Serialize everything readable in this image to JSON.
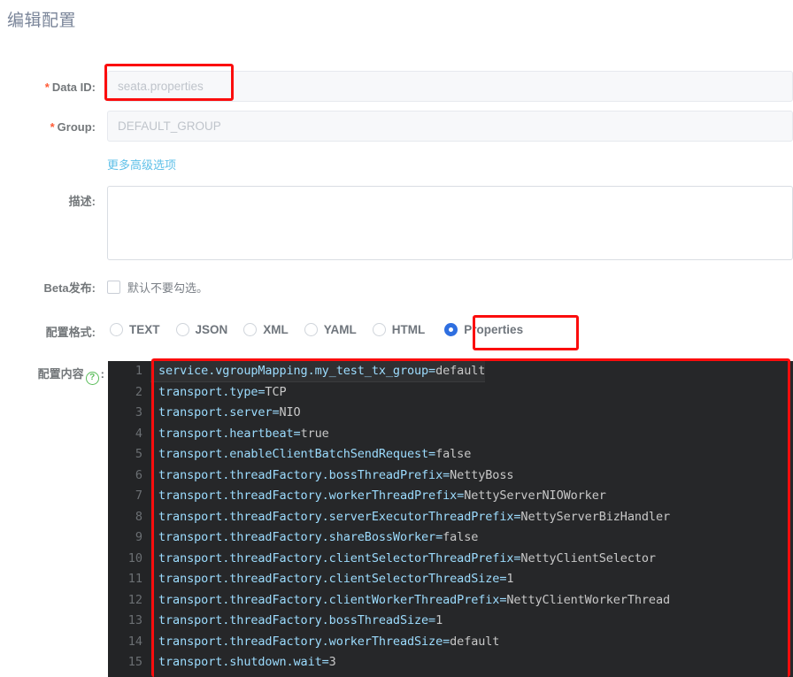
{
  "page": {
    "title": "编辑配置"
  },
  "form": {
    "data_id": {
      "label": "Data ID",
      "required_mark": "*",
      "value": "seata.properties",
      "placeholder": "seata.properties"
    },
    "group": {
      "label": "Group",
      "required_mark": "*",
      "value": "DEFAULT_GROUP",
      "placeholder": "DEFAULT_GROUP"
    },
    "advanced_link": "更多高级选项",
    "description": {
      "label": "描述",
      "value": "",
      "placeholder": ""
    },
    "beta": {
      "label": "Beta发布",
      "checkbox_text": "默认不要勾选。",
      "checked": false
    },
    "format": {
      "label": "配置格式",
      "selected": "Properties",
      "options": [
        "TEXT",
        "JSON",
        "XML",
        "YAML",
        "HTML",
        "Properties"
      ]
    },
    "content": {
      "label": "配置内容",
      "help_icon": "question-mark-icon",
      "help_glyph": "?",
      "colon": ":"
    }
  },
  "colors": {
    "annotation": "#fb0d0d",
    "radio_selected": "#2f6fe0",
    "link": "#5fc0e8",
    "required_star": "#ff5b36",
    "help": "#5bbd5b",
    "editor_bg": "#262729",
    "editor_gutter": "#232426",
    "code_key": "#9cdcfe",
    "code_value": "#c8c8c8"
  },
  "editor": {
    "lines": [
      {
        "n": "1",
        "key": "service.vgroupMapping.my_test_tx_group=",
        "val": "default"
      },
      {
        "n": "2",
        "key": "transport.type=",
        "val": "TCP"
      },
      {
        "n": "3",
        "key": "transport.server=",
        "val": "NIO"
      },
      {
        "n": "4",
        "key": "transport.heartbeat=",
        "val": "true"
      },
      {
        "n": "5",
        "key": "transport.enableClientBatchSendRequest=",
        "val": "false"
      },
      {
        "n": "6",
        "key": "transport.threadFactory.bossThreadPrefix=",
        "val": "NettyBoss"
      },
      {
        "n": "7",
        "key": "transport.threadFactory.workerThreadPrefix=",
        "val": "NettyServerNIOWorker"
      },
      {
        "n": "8",
        "key": "transport.threadFactory.serverExecutorThreadPrefix=",
        "val": "NettyServerBizHandler"
      },
      {
        "n": "9",
        "key": "transport.threadFactory.shareBossWorker=",
        "val": "false"
      },
      {
        "n": "10",
        "key": "transport.threadFactory.clientSelectorThreadPrefix=",
        "val": "NettyClientSelector"
      },
      {
        "n": "11",
        "key": "transport.threadFactory.clientSelectorThreadSize=",
        "val": "1"
      },
      {
        "n": "12",
        "key": "transport.threadFactory.clientWorkerThreadPrefix=",
        "val": "NettyClientWorkerThread"
      },
      {
        "n": "13",
        "key": "transport.threadFactory.bossThreadSize=",
        "val": "1"
      },
      {
        "n": "14",
        "key": "transport.threadFactory.workerThreadSize=",
        "val": "default"
      },
      {
        "n": "15",
        "key": "transport.shutdown.wait=",
        "val": "3"
      }
    ]
  }
}
